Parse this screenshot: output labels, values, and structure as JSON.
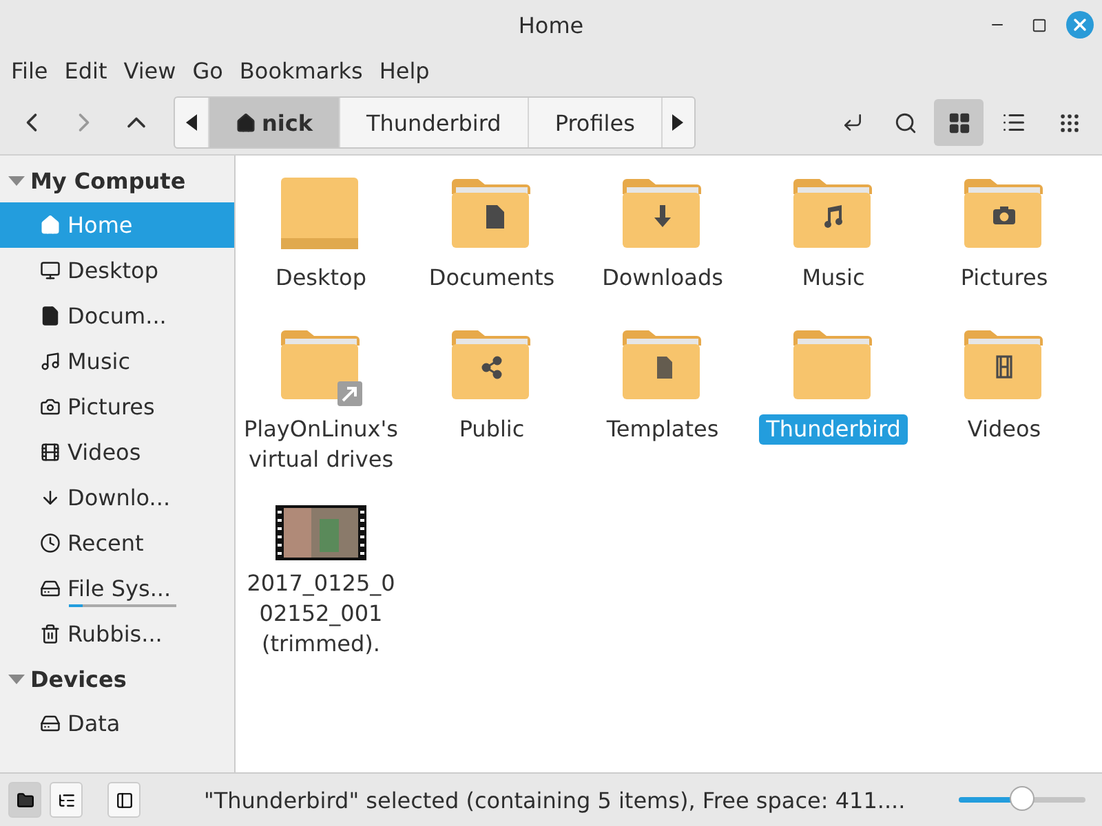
{
  "window": {
    "title": "Home"
  },
  "menu": [
    "File",
    "Edit",
    "View",
    "Go",
    "Bookmarks",
    "Help"
  ],
  "toolbar": {
    "path": [
      {
        "label": "nick",
        "kind": "home",
        "selected": true
      },
      {
        "label": "Thunderbird",
        "kind": "plain",
        "selected": false
      },
      {
        "label": "Profiles",
        "kind": "plain",
        "selected": false
      }
    ],
    "views": [
      {
        "kind": "icons",
        "selected": true
      },
      {
        "kind": "list",
        "selected": false
      },
      {
        "kind": "compact",
        "selected": false
      }
    ]
  },
  "sidebar": [
    {
      "title": "My Compute",
      "expanded": true,
      "items": [
        {
          "label": "Home",
          "kind": "home",
          "selected": true
        },
        {
          "label": "Desktop",
          "kind": "desktop",
          "selected": false
        },
        {
          "label": "Docum...",
          "kind": "document",
          "selected": false
        },
        {
          "label": "Music",
          "kind": "music",
          "selected": false
        },
        {
          "label": "Pictures",
          "kind": "camera",
          "selected": false
        },
        {
          "label": "Videos",
          "kind": "film",
          "selected": false
        },
        {
          "label": "Downlo...",
          "kind": "download",
          "selected": false
        },
        {
          "label": "Recent",
          "kind": "clock",
          "selected": false
        },
        {
          "label": "File Sys...",
          "kind": "drive",
          "selected": false,
          "level": 0.13
        },
        {
          "label": "Rubbis...",
          "kind": "trash",
          "selected": false
        }
      ]
    },
    {
      "title": "Devices",
      "expanded": true,
      "items": [
        {
          "label": "Data",
          "kind": "drive",
          "selected": false
        }
      ]
    }
  ],
  "files": [
    {
      "name": "Desktop",
      "kind": "desktop",
      "selected": false
    },
    {
      "name": "Documents",
      "kind": "document",
      "selected": false
    },
    {
      "name": "Downloads",
      "kind": "download",
      "selected": false
    },
    {
      "name": "Music",
      "kind": "music",
      "selected": false
    },
    {
      "name": "Pictures",
      "kind": "camera",
      "selected": false
    },
    {
      "name": "PlayOnLinux's virtual drives",
      "kind": "link",
      "selected": false
    },
    {
      "name": "Public",
      "kind": "share",
      "selected": false
    },
    {
      "name": "Templates",
      "kind": "template",
      "selected": false
    },
    {
      "name": "Thunderbird",
      "kind": "plain",
      "selected": true
    },
    {
      "name": "Videos",
      "kind": "film",
      "selected": false
    },
    {
      "name": "2017_0125_002152_001 (trimmed).",
      "kind": "video",
      "selected": false
    }
  ],
  "status_bar": {
    "panes": [
      {
        "kind": "places",
        "selected": true
      },
      {
        "kind": "tree",
        "selected": false
      },
      {
        "kind": "hide",
        "selected": false
      }
    ],
    "text": "\"Thunderbird\" selected (containing 5 items), Free space: 411....",
    "zoom": {
      "level": 0.5
    }
  }
}
